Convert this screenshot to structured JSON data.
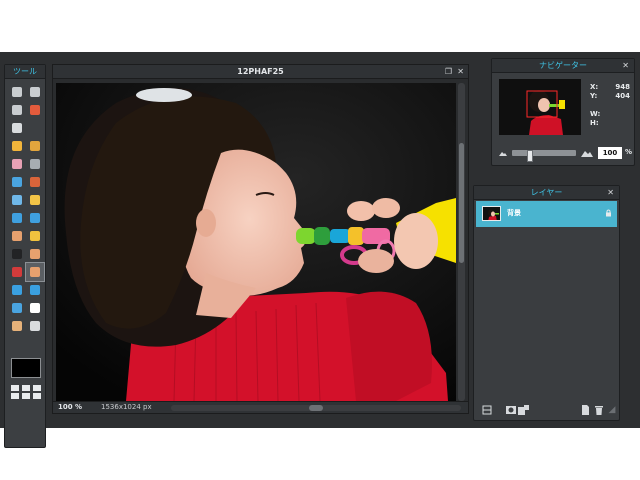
{
  "tools_panel": {
    "title": "ツール",
    "tools": [
      {
        "name": "crop-tool-icon",
        "color": "#c9cdd0"
      },
      {
        "name": "move-tool-icon",
        "color": "#c9cdd0"
      },
      {
        "name": "marquee-tool-icon",
        "color": "#c9cdd0"
      },
      {
        "name": "lasso-tool-icon",
        "color": "#e35b3c"
      },
      {
        "name": "magic-wand-tool-icon",
        "color": "#d9dcde"
      },
      null,
      {
        "name": "pencil-tool-icon",
        "color": "#f2b53b"
      },
      {
        "name": "brush-tool-icon",
        "color": "#e2a53d"
      },
      {
        "name": "eraser-tool-icon",
        "color": "#e8a1b5"
      },
      {
        "name": "paint-bucket-tool-icon",
        "color": "#a7adb2"
      },
      {
        "name": "gradient-tool-icon",
        "color": "#4aa4e0"
      },
      {
        "name": "clone-stamp-tool-icon",
        "color": "#d9643a"
      },
      {
        "name": "color-replace-tool-icon",
        "color": "#6fb7e8"
      },
      {
        "name": "drawing-tool-icon",
        "color": "#f3c447"
      },
      {
        "name": "blur-tool-icon",
        "color": "#3fa0df"
      },
      {
        "name": "sharpen-tool-icon",
        "color": "#3fa0df"
      },
      {
        "name": "smudge-tool-icon",
        "color": "#e7a16e"
      },
      {
        "name": "sponge-tool-icon",
        "color": "#f0c23e"
      },
      {
        "name": "dodge-tool-icon",
        "color": "#222325"
      },
      {
        "name": "burn-tool-icon",
        "color": "#e7a16e"
      },
      {
        "name": "red-eye-tool-icon",
        "color": "#d23b3b"
      },
      {
        "name": "spot-heal-tool-icon",
        "color": "#e7a16e"
      },
      {
        "name": "bloat-tool-icon",
        "color": "#3aa0e0"
      },
      {
        "name": "pinch-tool-icon",
        "color": "#3aa0e0"
      },
      {
        "name": "color-picker-tool-icon",
        "color": "#4aa4e0"
      },
      {
        "name": "type-tool-icon",
        "color": "#ffffff"
      },
      {
        "name": "hand-tool-icon",
        "color": "#e7b27a"
      },
      {
        "name": "zoom-tool-icon",
        "color": "#d9dcde"
      }
    ],
    "active_tool_index": 21,
    "primary_color": "#000000"
  },
  "canvas": {
    "title": "12PHAF25",
    "zoom": "100",
    "zoom_unit": "%",
    "dimensions": "1536x1024 px"
  },
  "navigator": {
    "title": "ナビゲーター",
    "x_label": "X:",
    "x_value": "948",
    "y_label": "Y:",
    "y_value": "404",
    "w_label": "W:",
    "w_value": "",
    "h_label": "H:",
    "h_value": "",
    "zoom": "100",
    "zoom_unit": "%",
    "zoom_level": 0.25
  },
  "layers": {
    "title": "レイヤー",
    "items": [
      {
        "name": "背景",
        "locked": true
      }
    ]
  }
}
